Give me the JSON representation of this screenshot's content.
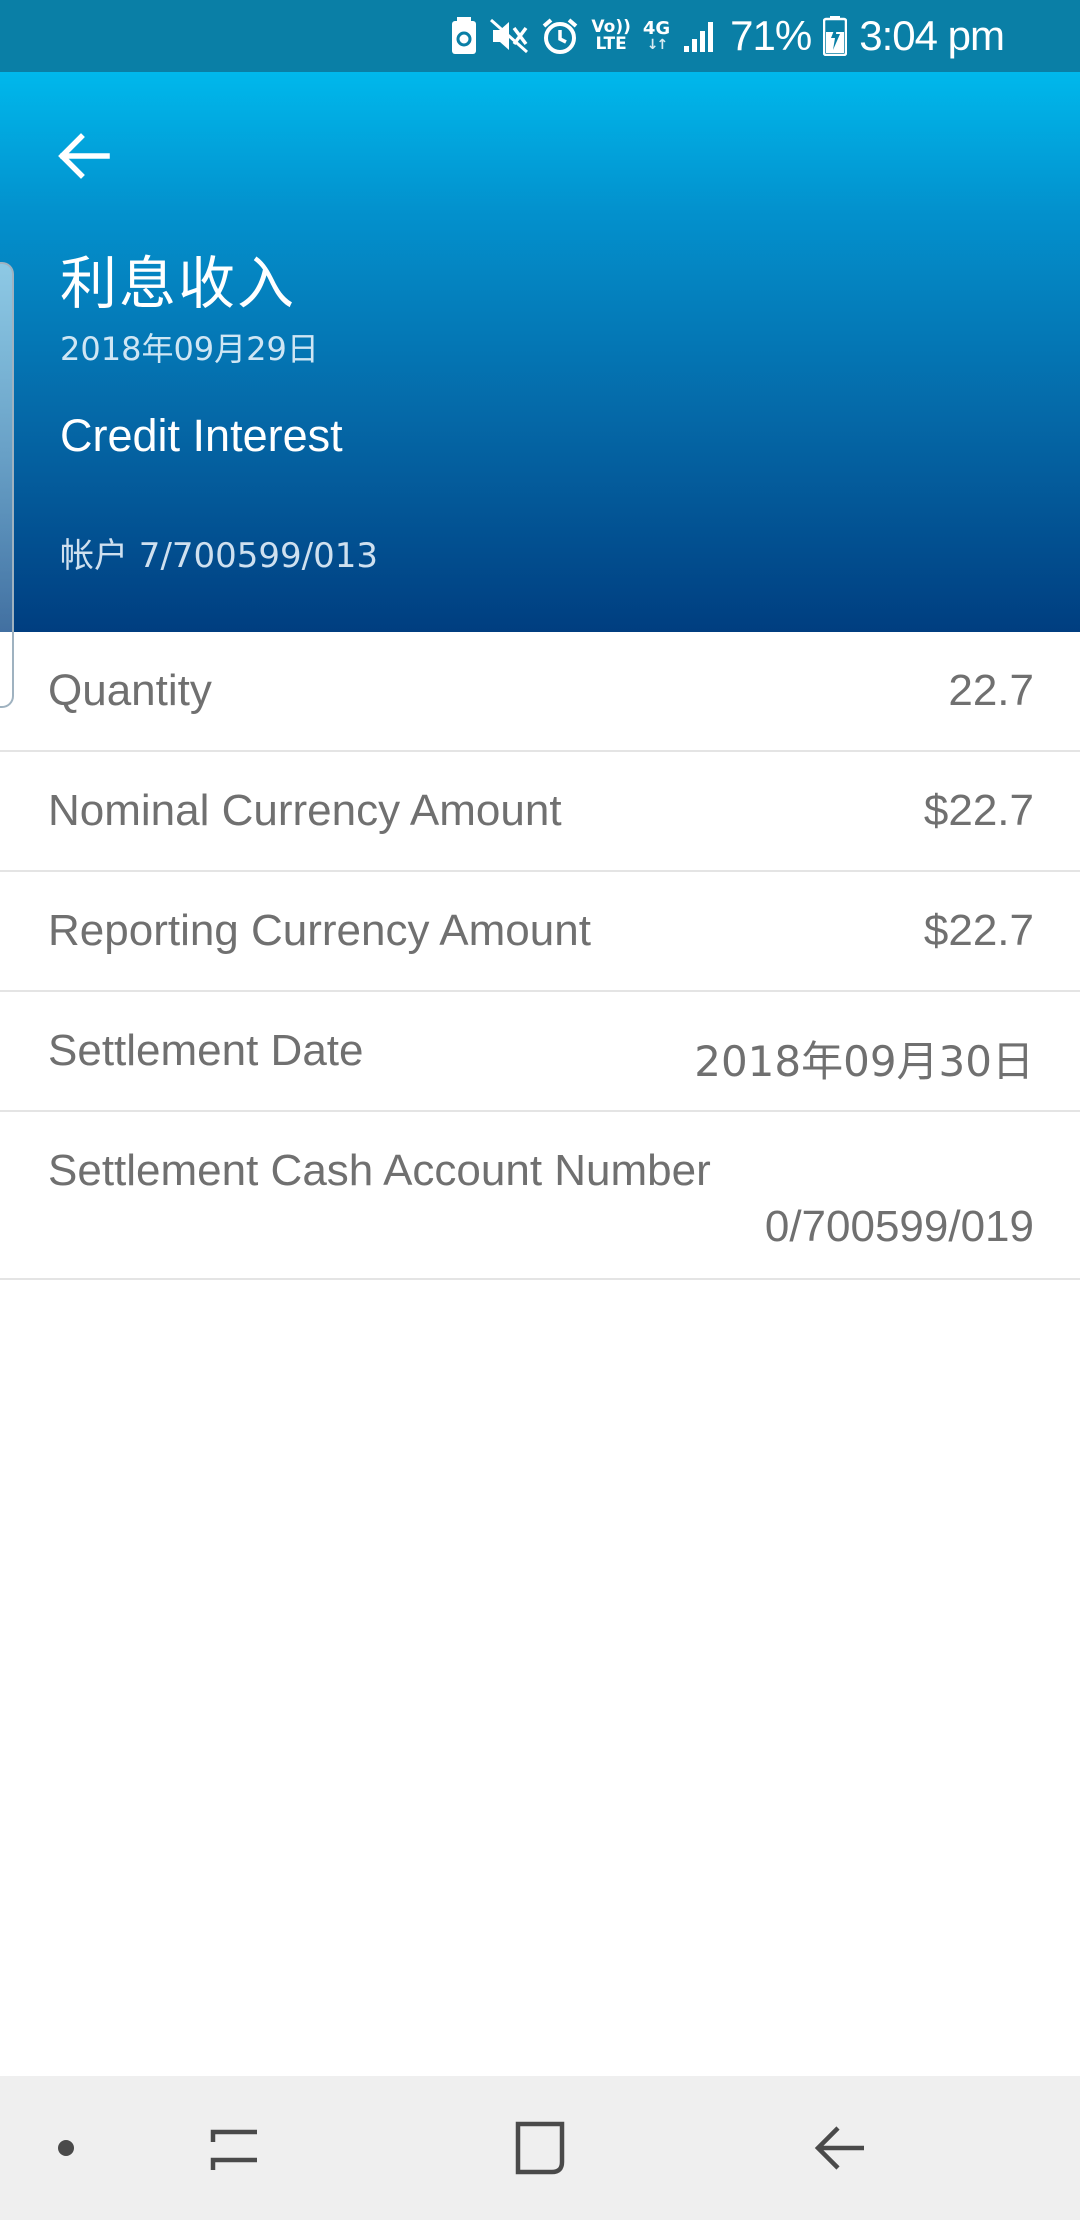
{
  "status_bar": {
    "icons": [
      "battery-saver-icon",
      "mute-icon",
      "alarm-icon",
      "volte-icon",
      "4g-data-icon",
      "signal-icon",
      "battery-charging-icon"
    ],
    "volte_top": "Vo))",
    "volte_bottom": "LTE",
    "network": "4G",
    "battery_percent": "71%",
    "time": "3:04 pm"
  },
  "header": {
    "title_zh": "利息收入",
    "date": "2018年09月29日",
    "title_en": "Credit Interest",
    "account": "帐户 7/700599/013",
    "colors": {
      "gradient_top": "#00b8ec",
      "gradient_bottom": "#003e80"
    }
  },
  "details": [
    {
      "label": "Quantity",
      "value": "22.7"
    },
    {
      "label": "Nominal Currency Amount",
      "value": "$22.7"
    },
    {
      "label": "Reporting Currency Amount",
      "value": "$22.7"
    },
    {
      "label": "Settlement Date",
      "value": "2018年09月30日"
    },
    {
      "label": "Settlement Cash Account Number",
      "value": "0/700599/019"
    }
  ],
  "nav": {
    "buttons": [
      "dot-icon",
      "recent-apps-icon",
      "home-icon",
      "back-icon"
    ]
  }
}
